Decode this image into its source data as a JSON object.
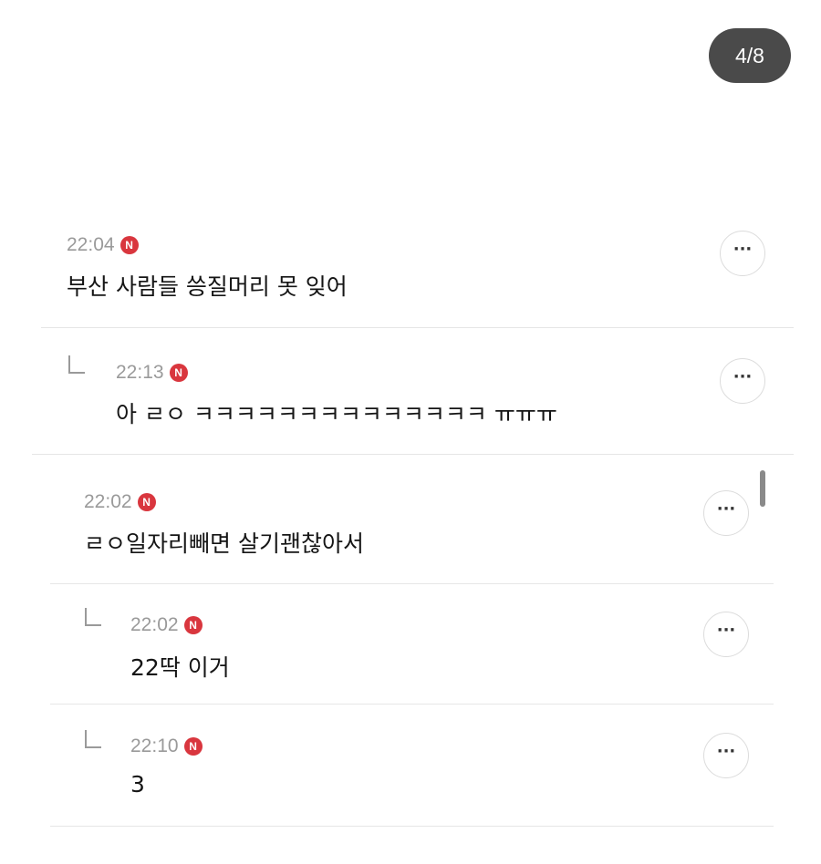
{
  "page_counter": "4/8",
  "comments": [
    {
      "time": "22:04",
      "badge": "N",
      "text": "부산 사람들 씅질머리 못 잊어",
      "more": "···",
      "is_reply": false
    },
    {
      "time": "22:13",
      "badge": "N",
      "text": "아 ㄹㅇ ㅋㅋㅋㅋㅋㅋㅋㅋㅋㅋㅋㅋㅋㅋ ㅠㅠㅠ",
      "more": "···",
      "is_reply": true
    },
    {
      "time": "22:02",
      "badge": "N",
      "text": "ㄹㅇ일자리빼면 살기괜찮아서",
      "more": "···",
      "is_reply": false
    },
    {
      "time": "22:02",
      "badge": "N",
      "text": "22딱 이거",
      "more": "···",
      "is_reply": true
    },
    {
      "time": "22:10",
      "badge": "N",
      "text": "3",
      "more": "···",
      "is_reply": true
    }
  ],
  "icons": {
    "reply": "reply-arrow-icon",
    "more": "more-options-icon",
    "new": "new-badge-icon"
  },
  "colors": {
    "badge": "#d9363e",
    "counter_bg": "#4a4a4a",
    "time": "#9a9a9a"
  }
}
